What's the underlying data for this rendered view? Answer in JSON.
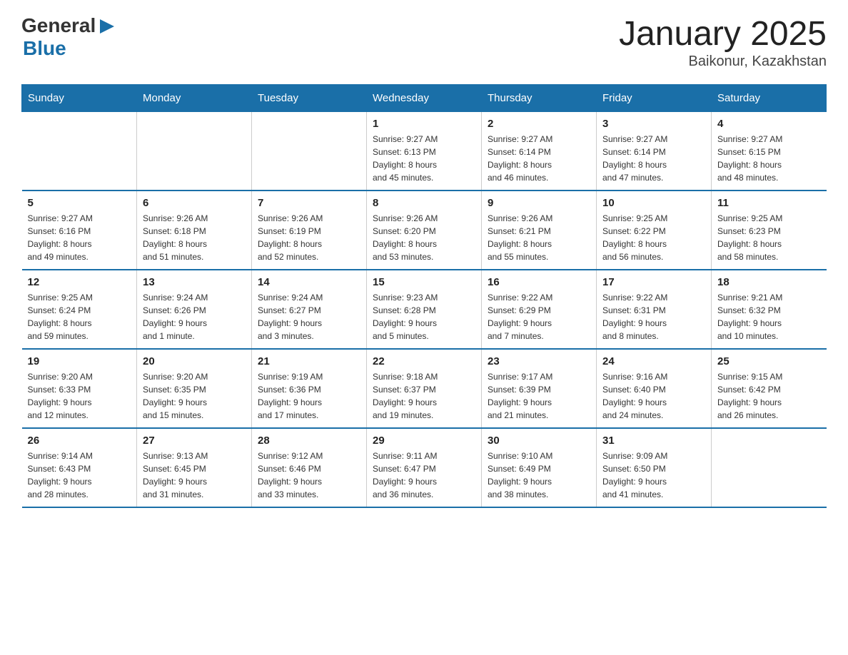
{
  "header": {
    "logo_general": "General",
    "logo_blue": "Blue",
    "month_title": "January 2025",
    "location": "Baikonur, Kazakhstan"
  },
  "days_of_week": [
    "Sunday",
    "Monday",
    "Tuesday",
    "Wednesday",
    "Thursday",
    "Friday",
    "Saturday"
  ],
  "weeks": [
    [
      {
        "day": "",
        "info": ""
      },
      {
        "day": "",
        "info": ""
      },
      {
        "day": "",
        "info": ""
      },
      {
        "day": "1",
        "info": "Sunrise: 9:27 AM\nSunset: 6:13 PM\nDaylight: 8 hours\nand 45 minutes."
      },
      {
        "day": "2",
        "info": "Sunrise: 9:27 AM\nSunset: 6:14 PM\nDaylight: 8 hours\nand 46 minutes."
      },
      {
        "day": "3",
        "info": "Sunrise: 9:27 AM\nSunset: 6:14 PM\nDaylight: 8 hours\nand 47 minutes."
      },
      {
        "day": "4",
        "info": "Sunrise: 9:27 AM\nSunset: 6:15 PM\nDaylight: 8 hours\nand 48 minutes."
      }
    ],
    [
      {
        "day": "5",
        "info": "Sunrise: 9:27 AM\nSunset: 6:16 PM\nDaylight: 8 hours\nand 49 minutes."
      },
      {
        "day": "6",
        "info": "Sunrise: 9:26 AM\nSunset: 6:18 PM\nDaylight: 8 hours\nand 51 minutes."
      },
      {
        "day": "7",
        "info": "Sunrise: 9:26 AM\nSunset: 6:19 PM\nDaylight: 8 hours\nand 52 minutes."
      },
      {
        "day": "8",
        "info": "Sunrise: 9:26 AM\nSunset: 6:20 PM\nDaylight: 8 hours\nand 53 minutes."
      },
      {
        "day": "9",
        "info": "Sunrise: 9:26 AM\nSunset: 6:21 PM\nDaylight: 8 hours\nand 55 minutes."
      },
      {
        "day": "10",
        "info": "Sunrise: 9:25 AM\nSunset: 6:22 PM\nDaylight: 8 hours\nand 56 minutes."
      },
      {
        "day": "11",
        "info": "Sunrise: 9:25 AM\nSunset: 6:23 PM\nDaylight: 8 hours\nand 58 minutes."
      }
    ],
    [
      {
        "day": "12",
        "info": "Sunrise: 9:25 AM\nSunset: 6:24 PM\nDaylight: 8 hours\nand 59 minutes."
      },
      {
        "day": "13",
        "info": "Sunrise: 9:24 AM\nSunset: 6:26 PM\nDaylight: 9 hours\nand 1 minute."
      },
      {
        "day": "14",
        "info": "Sunrise: 9:24 AM\nSunset: 6:27 PM\nDaylight: 9 hours\nand 3 minutes."
      },
      {
        "day": "15",
        "info": "Sunrise: 9:23 AM\nSunset: 6:28 PM\nDaylight: 9 hours\nand 5 minutes."
      },
      {
        "day": "16",
        "info": "Sunrise: 9:22 AM\nSunset: 6:29 PM\nDaylight: 9 hours\nand 7 minutes."
      },
      {
        "day": "17",
        "info": "Sunrise: 9:22 AM\nSunset: 6:31 PM\nDaylight: 9 hours\nand 8 minutes."
      },
      {
        "day": "18",
        "info": "Sunrise: 9:21 AM\nSunset: 6:32 PM\nDaylight: 9 hours\nand 10 minutes."
      }
    ],
    [
      {
        "day": "19",
        "info": "Sunrise: 9:20 AM\nSunset: 6:33 PM\nDaylight: 9 hours\nand 12 minutes."
      },
      {
        "day": "20",
        "info": "Sunrise: 9:20 AM\nSunset: 6:35 PM\nDaylight: 9 hours\nand 15 minutes."
      },
      {
        "day": "21",
        "info": "Sunrise: 9:19 AM\nSunset: 6:36 PM\nDaylight: 9 hours\nand 17 minutes."
      },
      {
        "day": "22",
        "info": "Sunrise: 9:18 AM\nSunset: 6:37 PM\nDaylight: 9 hours\nand 19 minutes."
      },
      {
        "day": "23",
        "info": "Sunrise: 9:17 AM\nSunset: 6:39 PM\nDaylight: 9 hours\nand 21 minutes."
      },
      {
        "day": "24",
        "info": "Sunrise: 9:16 AM\nSunset: 6:40 PM\nDaylight: 9 hours\nand 24 minutes."
      },
      {
        "day": "25",
        "info": "Sunrise: 9:15 AM\nSunset: 6:42 PM\nDaylight: 9 hours\nand 26 minutes."
      }
    ],
    [
      {
        "day": "26",
        "info": "Sunrise: 9:14 AM\nSunset: 6:43 PM\nDaylight: 9 hours\nand 28 minutes."
      },
      {
        "day": "27",
        "info": "Sunrise: 9:13 AM\nSunset: 6:45 PM\nDaylight: 9 hours\nand 31 minutes."
      },
      {
        "day": "28",
        "info": "Sunrise: 9:12 AM\nSunset: 6:46 PM\nDaylight: 9 hours\nand 33 minutes."
      },
      {
        "day": "29",
        "info": "Sunrise: 9:11 AM\nSunset: 6:47 PM\nDaylight: 9 hours\nand 36 minutes."
      },
      {
        "day": "30",
        "info": "Sunrise: 9:10 AM\nSunset: 6:49 PM\nDaylight: 9 hours\nand 38 minutes."
      },
      {
        "day": "31",
        "info": "Sunrise: 9:09 AM\nSunset: 6:50 PM\nDaylight: 9 hours\nand 41 minutes."
      },
      {
        "day": "",
        "info": ""
      }
    ]
  ]
}
